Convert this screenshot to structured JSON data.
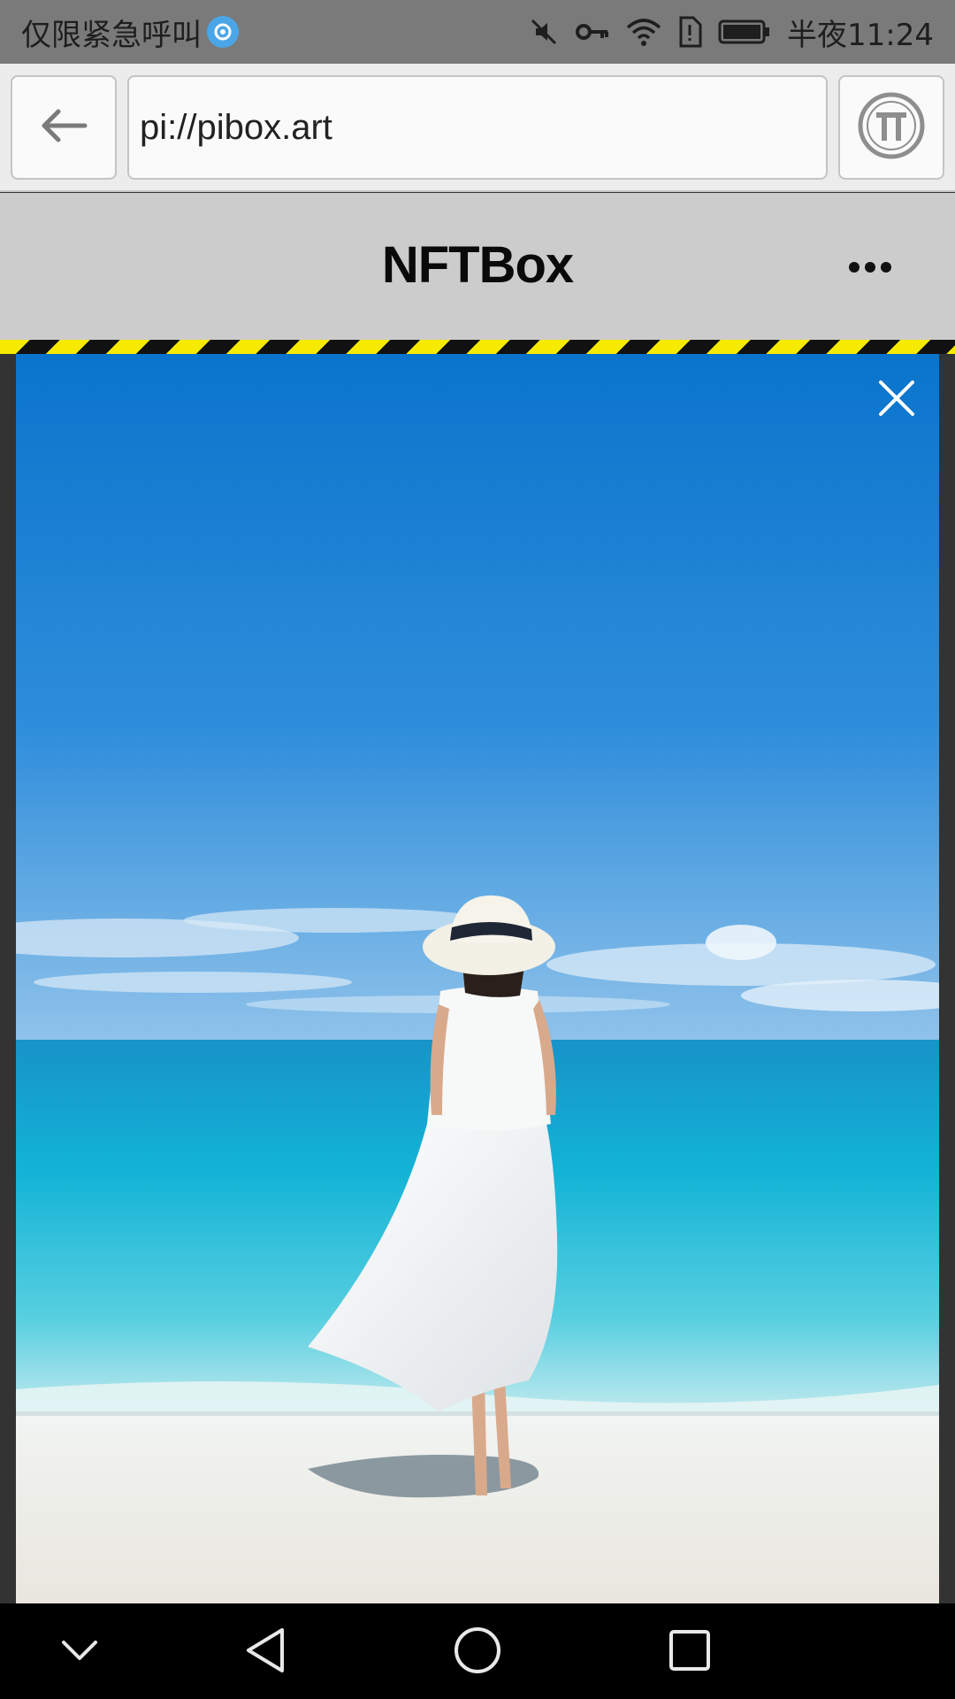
{
  "status_bar": {
    "carrier_text": "仅限紧急呼叫",
    "time": "半夜11:24",
    "icons": [
      "app-notification-icon",
      "mute-icon",
      "vpn-key-icon",
      "wifi-icon",
      "sim-alert-icon",
      "battery-icon"
    ]
  },
  "browser": {
    "url": "pi://pibox.art",
    "back_icon": "arrow-left-icon",
    "pi_icon": "pi-logo-icon"
  },
  "header": {
    "title": "NFTBox",
    "more_icon": "more-dots-icon"
  },
  "viewer": {
    "close_icon": "close-icon",
    "image_subject": "woman in white dress and sun hat on a tropical beach"
  },
  "nav_bar": {
    "icons": [
      "collapse-chevron-icon",
      "back-triangle-icon",
      "home-circle-icon",
      "recents-square-icon"
    ]
  },
  "colors": {
    "status_bar_bg": "#7a7a7a",
    "header_bg": "#cccccc",
    "hazard_yellow": "#f6ea00",
    "hazard_black": "#111111",
    "nav_bg": "#000000"
  }
}
